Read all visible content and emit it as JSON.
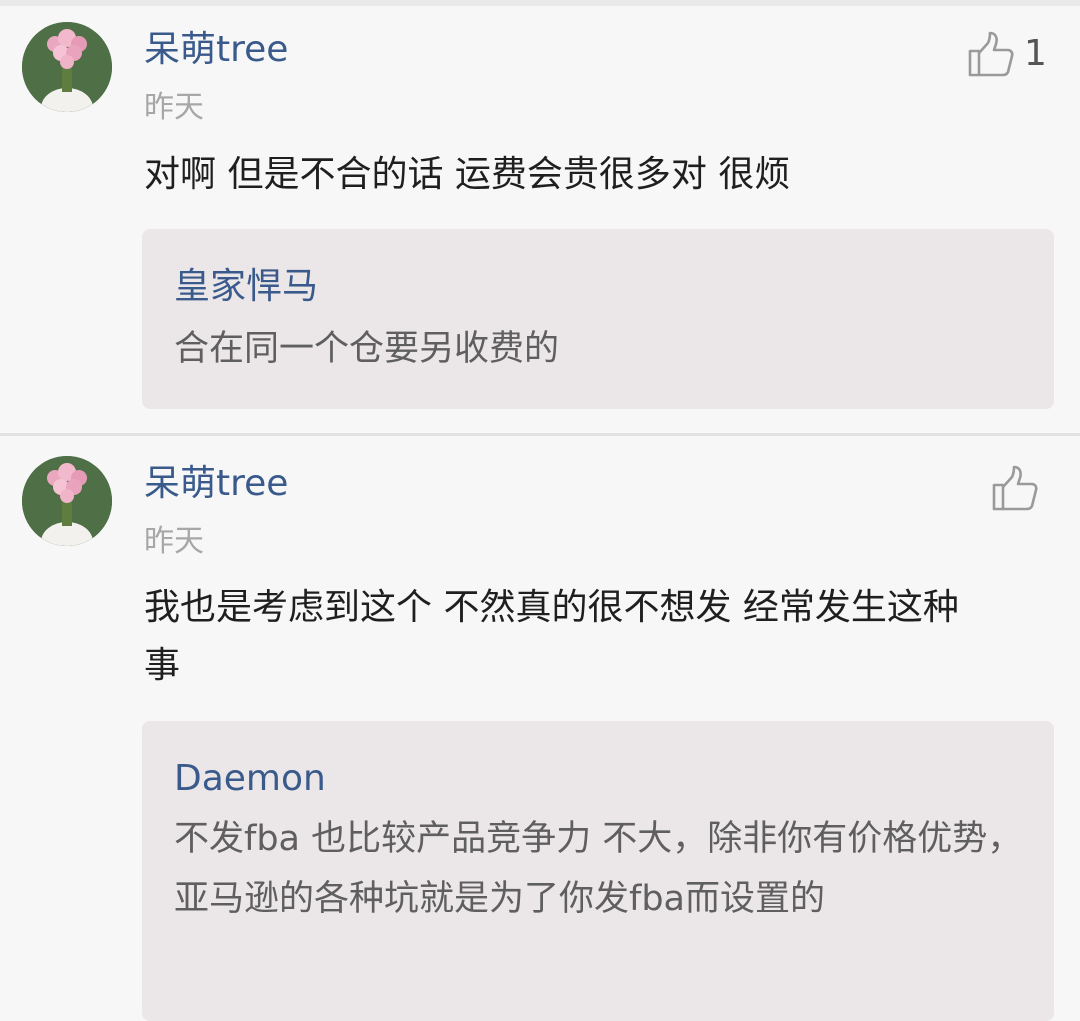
{
  "comments": [
    {
      "username": "呆萌tree",
      "time": "昨天",
      "content": "对啊 但是不合的话 运费会贵很多对 很烦",
      "like_count": "1",
      "reply": {
        "name": "皇家悍马",
        "text": "合在同一个仓要另收费的"
      }
    },
    {
      "username": "呆萌tree",
      "time": "昨天",
      "content": "我也是考虑到这个 不然真的很不想发 经常发生这种事",
      "like_count": "",
      "reply": {
        "name": "Daemon",
        "text": "不发fba 也比较产品竞争力 不大，除非你有价格优势，亚马逊的各种坑就是为了你发fba而设置的"
      }
    }
  ],
  "icons": {
    "avatar": "avatar-flowers-icon",
    "like": "thumbs-up-icon"
  },
  "colors": {
    "username": "#3a5a8c",
    "time": "#a7a7a7",
    "reply_bg": "#ebe7e8"
  }
}
